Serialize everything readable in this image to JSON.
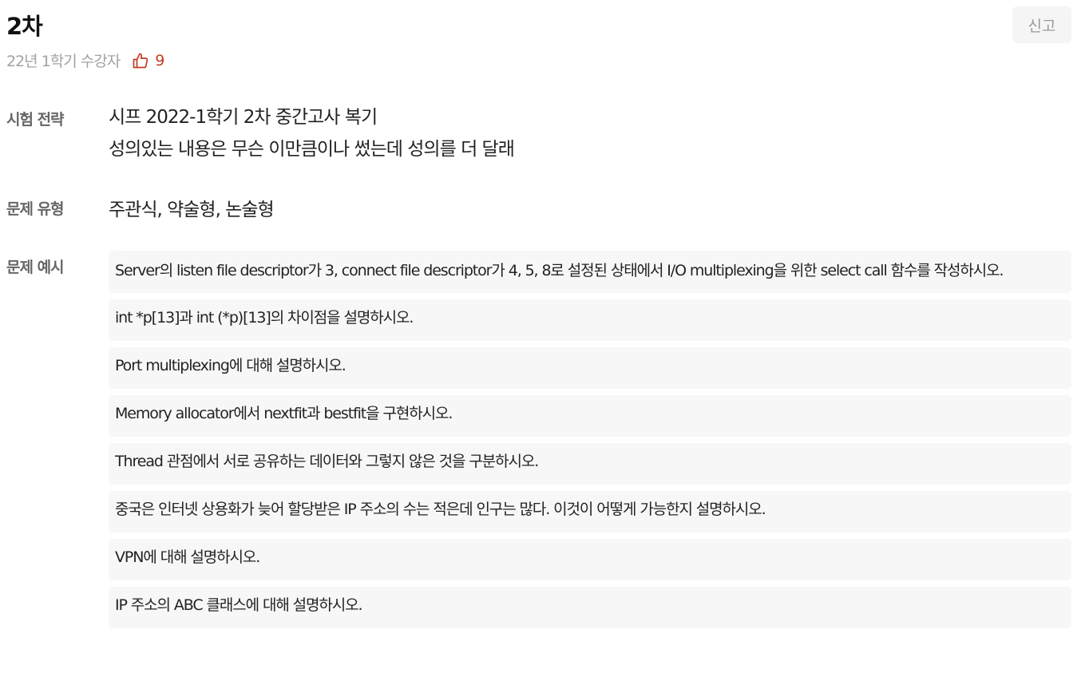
{
  "review": {
    "title": "2차",
    "report_label": "신고",
    "semester": "22년 1학기 수강자",
    "likes_count": "9"
  },
  "sections": {
    "strategy": {
      "label": "시험 전략",
      "lines": [
        "시프 2022-1학기 2차 중간고사 복기",
        "성의있는 내용은 무슨 이만큼이나 썼는데 성의를 더 달래"
      ]
    },
    "type": {
      "label": "문제 유형",
      "value": "주관식, 약술형, 논술형"
    },
    "examples": {
      "label": "문제 예시",
      "items": [
        "Server의 listen file descriptor가 3, connect file descriptor가 4, 5, 8로 설정된 상태에서 I/O multiplexing을 위한 select call 함수를 작성하시오.",
        "int *p[13]과 int (*p)[13]의 차이점을 설명하시오.",
        "Port multiplexing에 대해 설명하시오.",
        "Memory allocator에서 nextfit과 bestfit을 구현하시오.",
        "Thread 관점에서 서로 공유하는 데이터와 그렇지 않은 것을 구분하시오.",
        "중국은 인터넷 상용화가 늦어 할당받은 IP 주소의 수는 적은데 인구는 많다. 이것이 어떻게 가능한지 설명하시오.",
        "VPN에 대해 설명하시오.",
        "IP 주소의 ABC 클래스에 대해 설명하시오."
      ]
    }
  },
  "colors": {
    "accent": "#c43c24",
    "muted_text": "#a2a2a2",
    "label_text": "#666666",
    "card_background": "#f7f7f7"
  },
  "icons": {
    "like": "thumbs-up-icon"
  }
}
